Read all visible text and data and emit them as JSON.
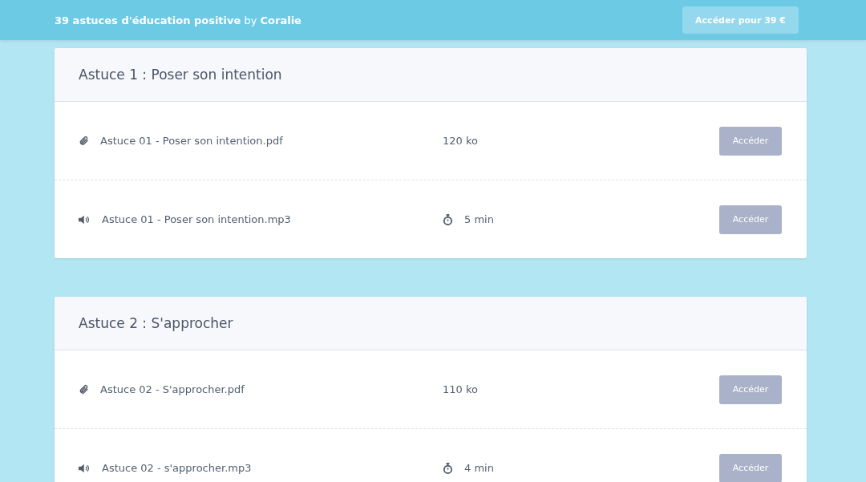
{
  "header": {
    "title": "**39 astuces d'éducation positive** by **Coralie**",
    "buy_button": "Accéder pour 39 €"
  },
  "sections": [
    {
      "title": "Astuce 1 : Poser son intention",
      "items": [
        {
          "kind": "file",
          "name": "Astuce 01 - Poser son intention.pdf",
          "meta": "120 ko",
          "button": "Accéder",
          "disabled": true
        },
        {
          "kind": "audio",
          "name": "Astuce 01 - Poser son intention.mp3",
          "meta": "5 min",
          "button": "Accéder",
          "disabled": true
        }
      ]
    },
    {
      "title": "Astuce 2 : S'approcher",
      "items": [
        {
          "kind": "file",
          "name": "Astuce 02 - S'approcher.pdf",
          "meta": "110 ko",
          "button": "Accéder",
          "disabled": true
        },
        {
          "kind": "audio",
          "name": "Astuce 02 - s'approcher.mp3",
          "meta": "4 min",
          "button": "Accéder",
          "disabled": true
        }
      ]
    }
  ]
}
